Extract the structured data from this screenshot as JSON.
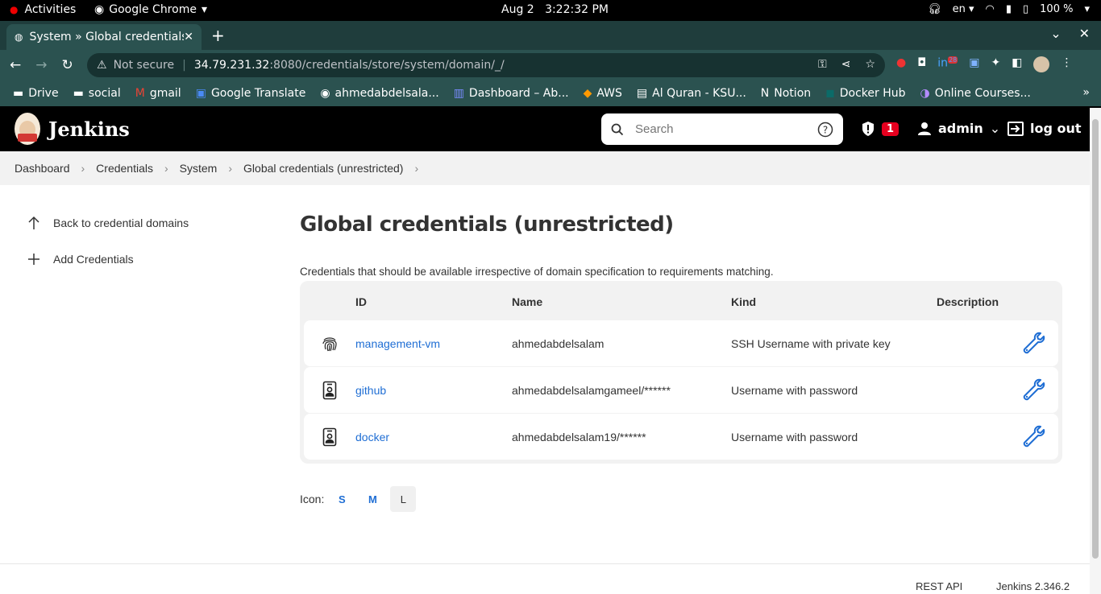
{
  "system_bar": {
    "activities": "Activities",
    "app": "Google Chrome",
    "date": "Aug 2",
    "time": "3:22:32 PM",
    "lang": "en",
    "battery": "100 %"
  },
  "browser": {
    "tab_title": "System » Global credentials",
    "url_security": "Not secure",
    "url_host": "34.79.231.32",
    "url_path": ":8080/credentials/store/system/domain/_/",
    "ext_badge": "28",
    "bookmarks": [
      {
        "label": "Drive",
        "icon": "folder-icon"
      },
      {
        "label": "social",
        "icon": "folder-icon"
      },
      {
        "label": "gmail",
        "icon": "gmail-icon"
      },
      {
        "label": "Google Translate",
        "icon": "translate-icon"
      },
      {
        "label": "ahmedabdelsala...",
        "icon": "github-icon"
      },
      {
        "label": "Dashboard – Ab...",
        "icon": "dashboard-icon"
      },
      {
        "label": "AWS",
        "icon": "aws-icon"
      },
      {
        "label": "Al Quran - KSU...",
        "icon": "quran-icon"
      },
      {
        "label": "Notion",
        "icon": "notion-icon"
      },
      {
        "label": "Docker Hub",
        "icon": "docker-icon"
      },
      {
        "label": "Online Courses...",
        "icon": "courses-icon"
      }
    ]
  },
  "jenkins_header": {
    "brand": "Jenkins",
    "search_placeholder": "Search",
    "security_count": "1",
    "user": "admin",
    "logout": "log out"
  },
  "breadcrumbs": [
    "Dashboard",
    "Credentials",
    "System",
    "Global credentials (unrestricted)"
  ],
  "sidebar": {
    "items": [
      {
        "label": "Back to credential domains",
        "icon": "arrow-up-icon"
      },
      {
        "label": "Add Credentials",
        "icon": "plus-icon"
      }
    ]
  },
  "main": {
    "title": "Global credentials (unrestricted)",
    "description": "Credentials that should be available irrespective of domain specification to requirements matching.",
    "columns": [
      "ID",
      "Name",
      "Kind",
      "Description"
    ],
    "rows": [
      {
        "id": "management-vm",
        "name": "ahmedabdelsalam",
        "kind": "SSH Username with private key",
        "description": "",
        "icon": "fingerprint-icon"
      },
      {
        "id": "github",
        "name": "ahmedabdelsalamgameel/******",
        "kind": "Username with password",
        "description": "",
        "icon": "id-card-icon"
      },
      {
        "id": "docker",
        "name": "ahmedabdelsalam19/******",
        "kind": "Username with password",
        "description": "",
        "icon": "id-card-icon"
      }
    ],
    "icon_size": {
      "label": "Icon:",
      "options": [
        "S",
        "M",
        "L"
      ],
      "selected": "L"
    }
  },
  "footer": {
    "rest_api": "REST API",
    "version": "Jenkins 2.346.2"
  }
}
